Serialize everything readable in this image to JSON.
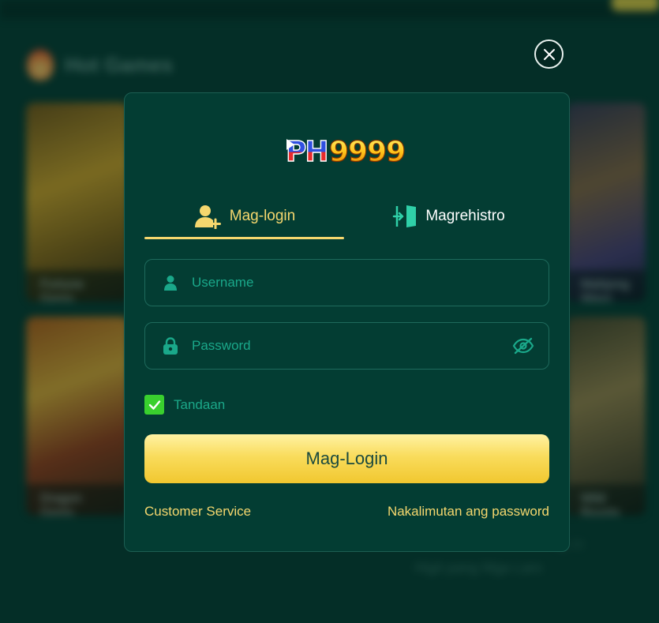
{
  "background": {
    "section_title": "Hot Games",
    "games": [
      {
        "name": "Fortune Gems"
      },
      {
        "name": "Dragon Gems"
      },
      {
        "name": "Mahjong Ways"
      },
      {
        "name": "Wild Bounty"
      }
    ],
    "load_more": "Higit pang Mga Laro",
    "showing_count": "ng 20"
  },
  "modal": {
    "logo_text": "PH9999",
    "tabs": [
      {
        "label": "Mag-login",
        "icon": "user-add-icon",
        "active": true
      },
      {
        "label": "Magrehistro",
        "icon": "register-door-icon",
        "active": false
      }
    ],
    "username": {
      "placeholder": "Username",
      "value": ""
    },
    "password": {
      "placeholder": "Password",
      "value": ""
    },
    "remember": {
      "label": "Tandaan",
      "checked": true
    },
    "submit_label": "Mag-Login",
    "customer_service": "Customer Service",
    "forgot_password": "Nakalimutan ang password"
  },
  "colors": {
    "accent": "#f5d76e",
    "panel": "#033d33",
    "field_text": "#1aa88a",
    "checkbox": "#39d02e"
  }
}
